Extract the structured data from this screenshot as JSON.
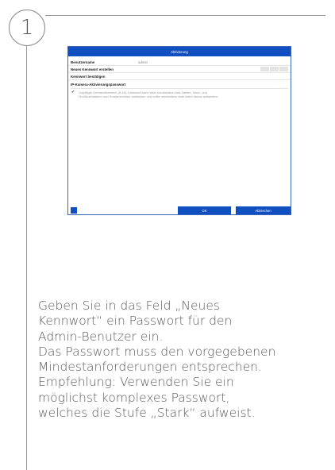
{
  "step": {
    "number": "1"
  },
  "dialog": {
    "title": "Aktivierung",
    "username_label": "Benutzername",
    "username_value": "admin",
    "new_password_label": "Neues Kennwort erstellen",
    "confirm_password_label": "Kennwort bestätigen",
    "ip_camera_label": "IP-Kamera-Aktivierungspasswort",
    "hint_line1": "Urgültiger Kennwortbereich [8-16]. Kennwort kann eine Kombination aus Zahlen, Klein- und",
    "hint_line2": "Großbuchstaben und Sonderzeichen aufweisen und sollte mindestens zwei Arten davon aufweisen.",
    "ok_label": "OK",
    "cancel_label": "Abbrechen",
    "colors": {
      "titlebar": "#0f4fbf",
      "button": "#0f4fbf"
    }
  },
  "instructions": {
    "lines": [
      "Geben Sie in das Feld „Neues",
      "Kennwort“ ein Passwort für den",
      "Admin-Benutzer ein.",
      "Das Passwort muss den vorgegebenen",
      "Mindestanforderungen entsprechen.",
      "Empfehlung: Verwenden Sie ein",
      "möglichst komplexes Passwort,",
      "welches die Stufe „Stark“ aufweist."
    ]
  }
}
